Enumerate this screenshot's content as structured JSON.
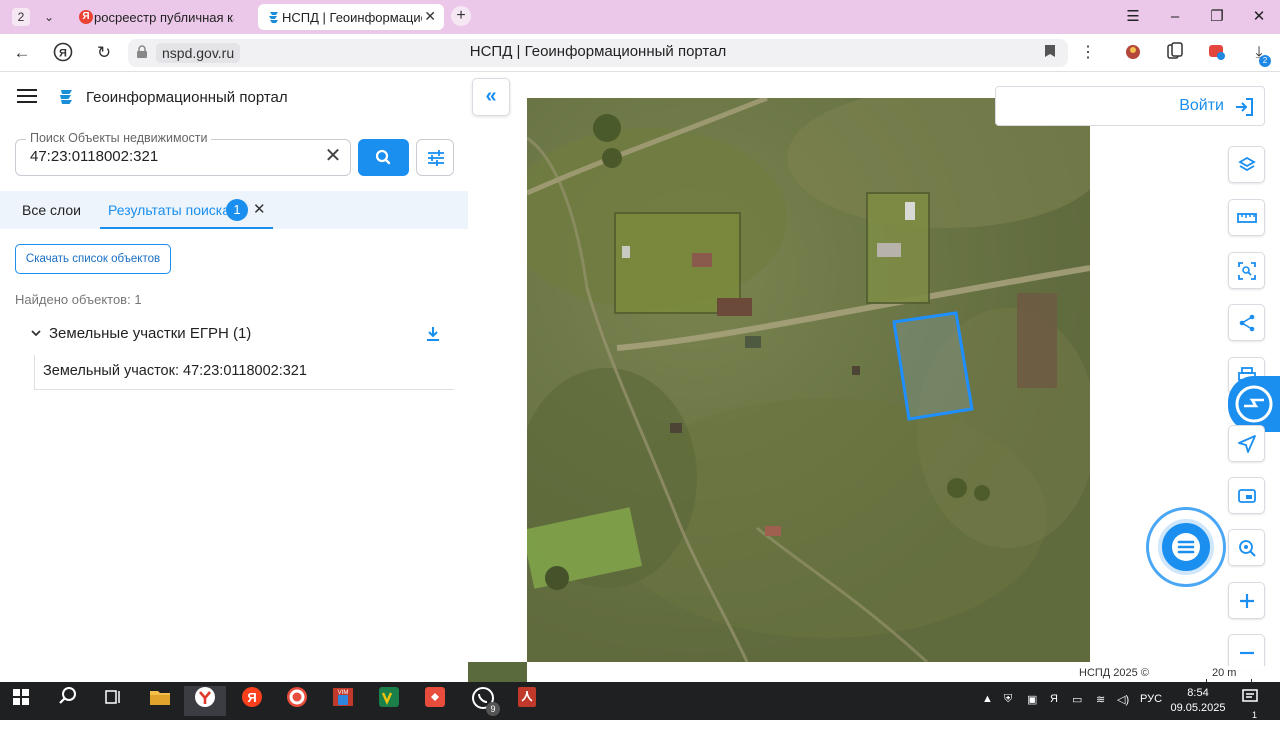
{
  "browser": {
    "tab_count": "2",
    "tabs": [
      {
        "title": "росреестр публичная кадастровая карта",
        "icon": "yandex-icon",
        "active": false
      },
      {
        "title": "НСПД | Геоинформационный портал",
        "icon": "nspd-icon",
        "active": true
      }
    ],
    "url_domain": "nspd.gov.ru",
    "page_title": "НСПД | Геоинформационный портал",
    "downloads_badge": "2"
  },
  "app": {
    "title": "Геоинформационный портал",
    "search": {
      "label": "Поиск Объекты недвижимости",
      "value": "47:23:0118002:321"
    },
    "tabs": {
      "all_layers": "Все слои",
      "results": "Результаты поиска",
      "results_count": "1"
    },
    "download_list_label": "Скачать список объектов",
    "found_text": "Найдено объектов: 1",
    "group": {
      "title": "Земельные участки ЕГРН (1)",
      "items": [
        "Земельный участок: 47:23:0118002:321"
      ]
    }
  },
  "map": {
    "login_label": "Войти",
    "attribution": "НСПД 2025 ©",
    "scale_label": "20 m",
    "tools": [
      "layers-icon",
      "ruler-icon",
      "select-area-icon",
      "share-icon",
      "print-icon",
      "navigate-icon",
      "picture-in-picture-icon",
      "search-location-icon",
      "zoom-in-icon",
      "zoom-out-icon"
    ],
    "parcel_color": "#1e8fff"
  },
  "taskbar": {
    "language": "РУС",
    "time": "8:54",
    "date": "09.05.2025",
    "whatsapp_badge": "9",
    "notification_badge": "1"
  },
  "colors": {
    "accent": "#1a8ff0",
    "tabstrip": "#ebc8e9"
  }
}
